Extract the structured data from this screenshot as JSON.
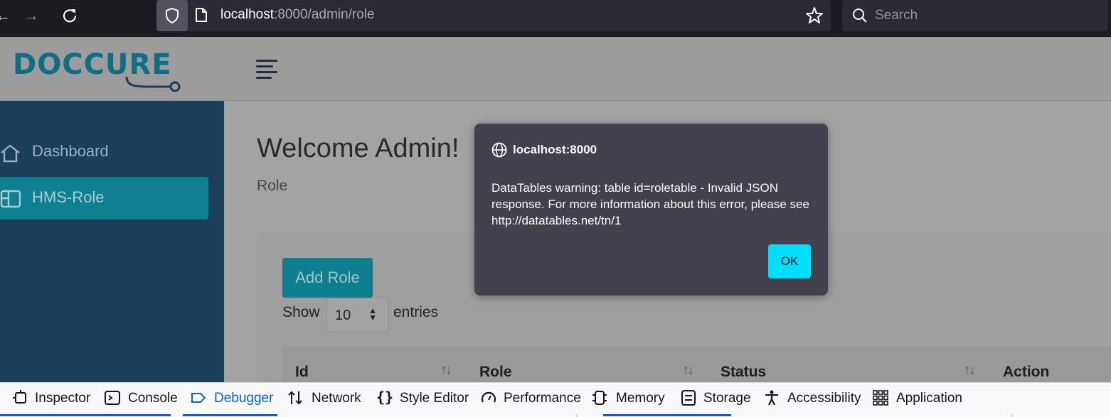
{
  "browser": {
    "url_host": "localhost",
    "url_rest": ":8000/admin/role",
    "search_placeholder": "Search"
  },
  "header": {
    "logo_text": "DOCCURE"
  },
  "sidebar": {
    "items": [
      {
        "label": "Dashboard",
        "icon": "home-icon"
      },
      {
        "label": "HMS-Role",
        "icon": "layout-icon",
        "active": true
      }
    ]
  },
  "main": {
    "title": "Welcome Admin!",
    "breadcrumb": "Role",
    "add_button": "Add Role",
    "show_label": "Show",
    "entries_value": "10",
    "entries_label": "entries",
    "columns": [
      "Id",
      "Role",
      "Status",
      "Action"
    ]
  },
  "dialog": {
    "origin": "localhost:8000",
    "message": "DataTables warning: table id=roletable - Invalid JSON response. For more information about this error, please see http://datatables.net/tn/1",
    "ok_label": "OK"
  },
  "devtools": {
    "tabs": [
      {
        "label": "Inspector",
        "icon": "inspector-icon"
      },
      {
        "label": "Console",
        "icon": "console-icon"
      },
      {
        "label": "Debugger",
        "icon": "debugger-icon",
        "active": true
      },
      {
        "label": "Network",
        "icon": "network-icon"
      },
      {
        "label": "Style Editor",
        "icon": "braces-icon"
      },
      {
        "label": "Performance",
        "icon": "gauge-icon"
      },
      {
        "label": "Memory",
        "icon": "memory-icon"
      },
      {
        "label": "Storage",
        "icon": "storage-icon"
      },
      {
        "label": "Accessibility",
        "icon": "accessibility-icon"
      },
      {
        "label": "Application",
        "icon": "grid-icon"
      }
    ]
  },
  "colors": {
    "accent_cyan": "#00ddff",
    "sidebar_bg": "#1b3e5a",
    "active_item": "#0e8091",
    "devtools_active": "#0060df"
  }
}
